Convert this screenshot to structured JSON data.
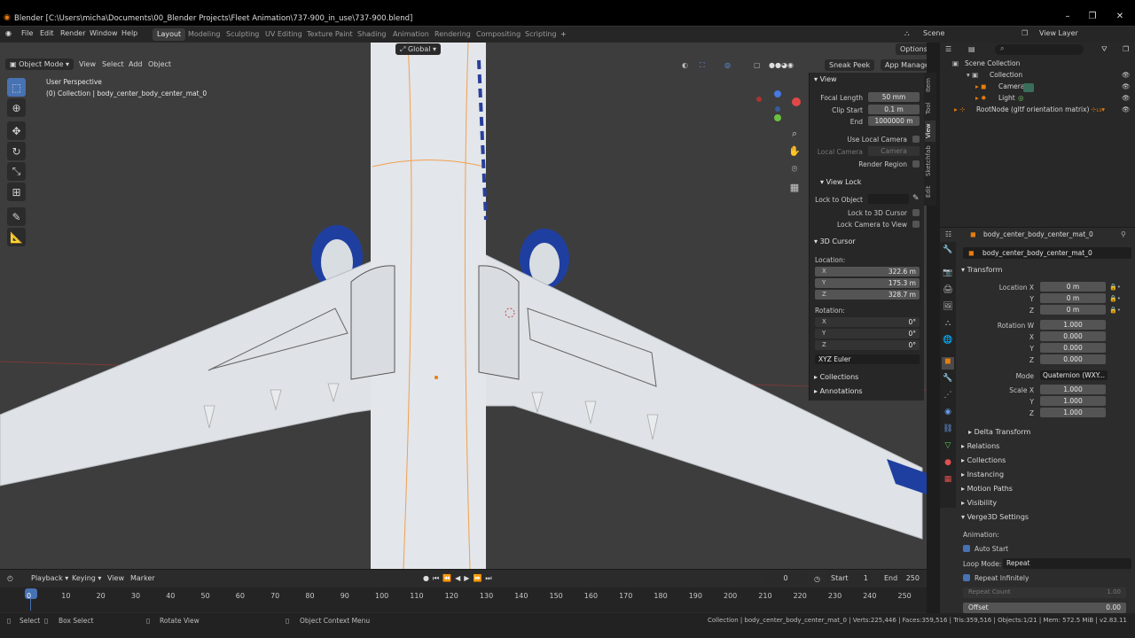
{
  "window": {
    "title": "Blender [C:\\Users\\micha\\Documents\\00_Blender Projects\\Fleet Animation\\737-900_in_use\\737-900.blend]"
  },
  "menu": [
    "File",
    "Edit",
    "Render",
    "Window",
    "Help"
  ],
  "workspaces": [
    "Layout",
    "Modeling",
    "Sculpting",
    "UV Editing",
    "Texture Paint",
    "Shading",
    "Animation",
    "Rendering",
    "Compositing",
    "Scripting"
  ],
  "topright": {
    "scene": "Scene",
    "view_layer": "View Layer"
  },
  "viewport": {
    "mode": "Object Mode",
    "menus": [
      "View",
      "Select",
      "Add",
      "Object"
    ],
    "orientation": "Global",
    "options": "Options",
    "perspective": "User Perspective",
    "collection_info": "(0) Collection | body_center_body_center_mat_0",
    "addons": [
      "Sneak Peek",
      "App Manager"
    ]
  },
  "npanel": {
    "tabs": [
      "Item",
      "Tool",
      "View",
      "Sketchfab",
      "Edit"
    ],
    "view": {
      "header": "View",
      "focal_label": "Focal Length",
      "focal": "50 mm",
      "clip_start_label": "Clip Start",
      "clip_start": "0.1 m",
      "end_label": "End",
      "clip_end": "1000000 m",
      "use_local_camera": "Use Local Camera",
      "local_camera_label": "Local Camera",
      "local_camera": "Camera",
      "render_region": "Render Region"
    },
    "view_lock": {
      "header": "View Lock",
      "lock_object": "Lock to Object",
      "lock_cursor": "Lock to 3D Cursor",
      "lock_camera": "Lock Camera to View"
    },
    "cursor": {
      "header": "3D Cursor",
      "location_label": "Location:",
      "x": "322.6 m",
      "y": "175.3 m",
      "z": "328.7 m",
      "rotation_label": "Rotation:",
      "rx": "0°",
      "ry": "0°",
      "rz": "0°",
      "mode": "XYZ Euler"
    },
    "collections": "Collections",
    "annotations": "Annotations"
  },
  "outliner": {
    "root": "Scene Collection",
    "items": [
      "Collection",
      "Camera",
      "Light",
      "RootNode (gltf orientation matrix)"
    ]
  },
  "properties": {
    "object_name": "body_center_body_center_mat_0",
    "data_name": "body_center_body_center_mat_0",
    "transform": "Transform",
    "location_x_label": "Location X",
    "loc_x": "0 m",
    "loc_y": "0 m",
    "loc_z": "0 m",
    "rotation_w_label": "Rotation W",
    "rot_w": "1.000",
    "rot_x": "0.000",
    "rot_y": "0.000",
    "rot_z": "0.000",
    "mode_label": "Mode",
    "mode": "Quaternion (WXY...",
    "scale_x_label": "Scale X",
    "scale_x": "1.000",
    "scale_y": "1.000",
    "scale_z": "1.000",
    "sections": [
      "Delta Transform",
      "Relations",
      "Collections",
      "Instancing",
      "Motion Paths",
      "Visibility",
      "Verge3D Settings"
    ],
    "animation_label": "Animation:",
    "auto_start": "Auto Start",
    "loop_mode_label": "Loop Mode:",
    "loop_mode": "Repeat",
    "repeat_infinitely": "Repeat Infinitely",
    "repeat_count": "Repeat Count",
    "repeat_count_val": "1.00",
    "offset": "Offset",
    "offset_val": "0.00",
    "axis": {
      "x": "X",
      "y": "Y",
      "z": "Z"
    }
  },
  "timeline": {
    "menus": [
      "Playback",
      "Keying",
      "View",
      "Marker"
    ],
    "current": "0",
    "start_label": "Start",
    "start": "1",
    "end_label": "End",
    "end": "250",
    "frames": [
      "0",
      "10",
      "20",
      "30",
      "40",
      "50",
      "60",
      "70",
      "80",
      "90",
      "100",
      "110",
      "120",
      "130",
      "140",
      "150",
      "160",
      "170",
      "180",
      "190",
      "200",
      "210",
      "220",
      "230",
      "240",
      "250"
    ]
  },
  "status": {
    "select": "Select",
    "box_select": "Box Select",
    "rotate_view": "Rotate View",
    "context_menu": "Object Context Menu",
    "info": "Collection | body_center_body_center_mat_0 | Verts:225,446 | Faces:359,516 | Tris:359,516 | Objects:1/21 | Mem: 572.5 MiB | v2.83.11"
  }
}
